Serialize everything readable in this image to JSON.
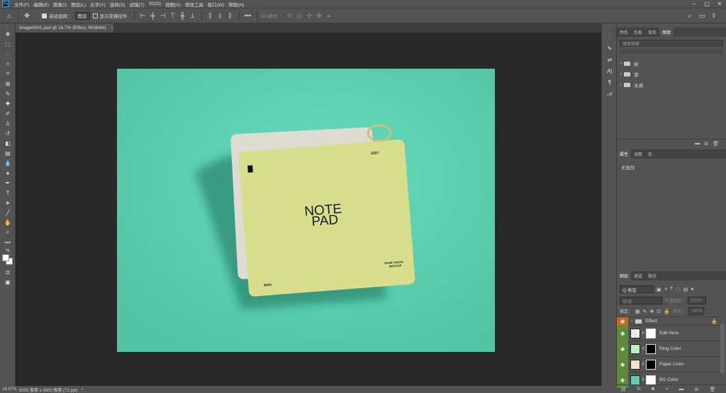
{
  "menubar": {
    "logo": "Ps",
    "items": [
      "文件(F)",
      "编辑(E)",
      "图像(I)",
      "图层(L)",
      "文字(Y)",
      "选择(S)",
      "滤镜(T)",
      "3D(D)",
      "视图(V)",
      "增效工具",
      "窗口(W)",
      "帮助(H)"
    ]
  },
  "optbar": {
    "auto_select_label": "自动选择：",
    "auto_select_value": "图层",
    "show_transform_label": "显示变换控件",
    "mode_3d_label": "3D 模式：",
    "more": "•••"
  },
  "document": {
    "tab_title": "Image0001.psd @ 16.7% (Effect, RGB/8#)",
    "tab_close": "×"
  },
  "canvas": {
    "bg_color": "#5ccfae",
    "card_color": "#d7df8d",
    "back_card_color": "#dedbd2",
    "title_line1": "NOTE",
    "title_line2": "PAD",
    "edit_label": "EDIT",
    "brand": "RVH",
    "corner_line1": "RVHR VISUAL",
    "corner_line2": "MOCKUP"
  },
  "statusbar": {
    "zoom": "16.67%",
    "info": "6000 像素 x 4500 像素 (72 ppi)",
    "arrow": "›"
  },
  "libraries_panel": {
    "tabs": [
      "颜色",
      "色板",
      "渐变",
      "图案"
    ],
    "search_placeholder": "搜索图案",
    "items": [
      "树",
      "草",
      "水滴"
    ]
  },
  "properties_panel": {
    "tabs": [
      "属性",
      "调整",
      "库"
    ],
    "empty_text": "无属性"
  },
  "layers_panel": {
    "tabs": [
      "图层",
      "通道",
      "路径"
    ],
    "filter_label": "Q 类型",
    "blend_mode": "穿透",
    "opacity_label": "不透明度：",
    "opacity_value": "100%",
    "lock_label": "锁定：",
    "fill_label": "填充：",
    "fill_value": "100%",
    "layers": [
      {
        "name": "Effect",
        "type": "group",
        "color": "#c86a1e"
      },
      {
        "name": "Edit Here",
        "type": "smart",
        "thumb": "#e6e6e6"
      },
      {
        "name": "Ring Color",
        "type": "fill",
        "thumb": "#b9f0c0"
      },
      {
        "name": "Paper Color",
        "type": "fill",
        "thumb": "#efe3c8"
      },
      {
        "name": "BG Color",
        "type": "fill",
        "thumb": "#5ccfae"
      }
    ]
  }
}
